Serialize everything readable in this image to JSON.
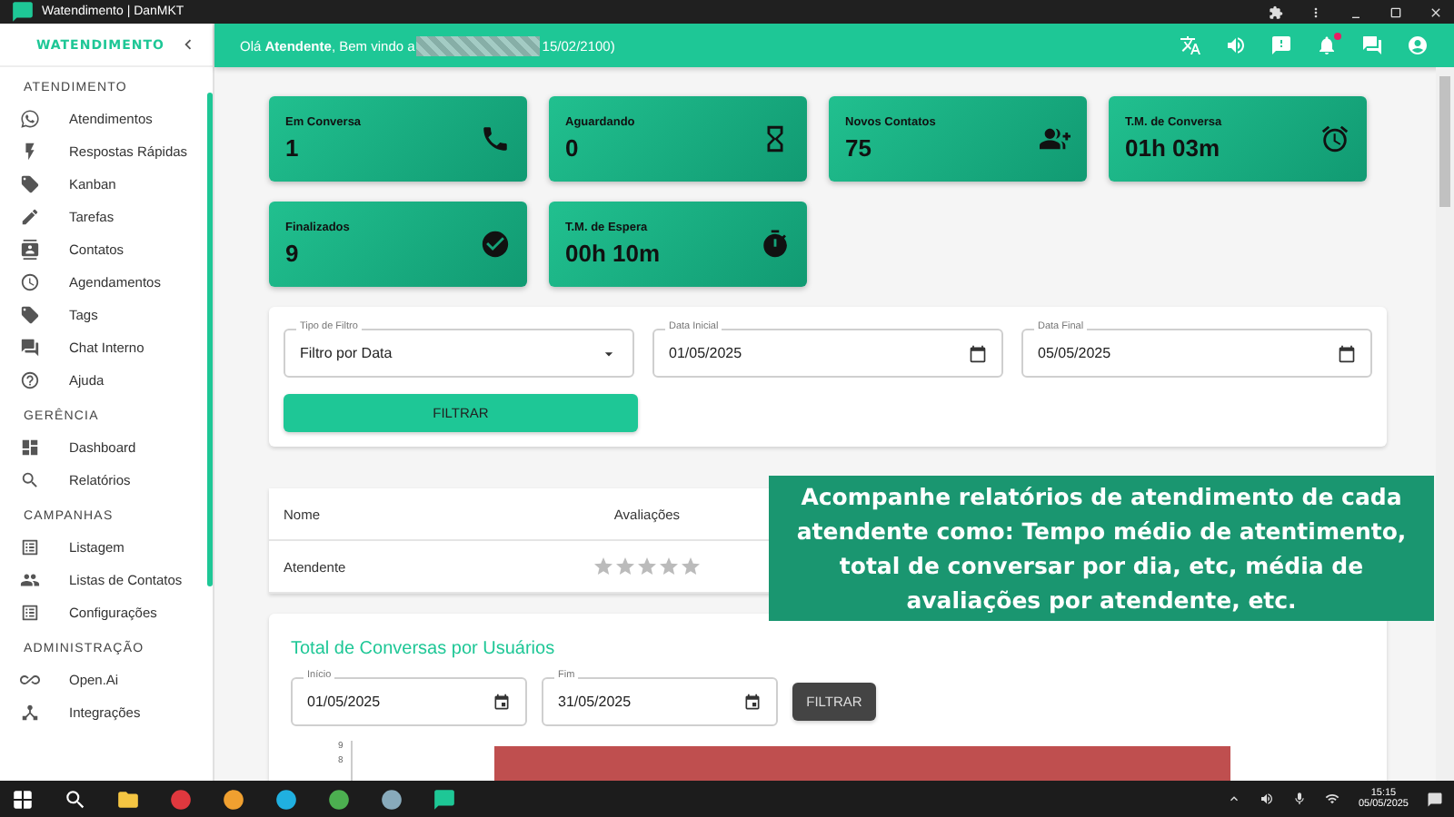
{
  "window": {
    "title": "Watendimento | DanMKT"
  },
  "sidebar": {
    "logo": "WATENDIMENTO",
    "sections": [
      {
        "title": "ATENDIMENTO",
        "items": [
          "Atendimentos",
          "Respostas Rápidas",
          "Kanban",
          "Tarefas",
          "Contatos",
          "Agendamentos",
          "Tags",
          "Chat Interno",
          "Ajuda"
        ]
      },
      {
        "title": "GERÊNCIA",
        "items": [
          "Dashboard",
          "Relatórios"
        ]
      },
      {
        "title": "CAMPANHAS",
        "items": [
          "Listagem",
          "Listas de Contatos",
          "Configurações"
        ]
      },
      {
        "title": "ADMINISTRAÇÃO",
        "items": [
          "Open.Ai",
          "Integrações"
        ]
      }
    ]
  },
  "header": {
    "greeting": "Olá **Atendente**, Bem vindo a",
    "suffix": "15/02/2100)",
    "notification_dot": true
  },
  "cards": [
    {
      "label": "Em Conversa",
      "value": "1"
    },
    {
      "label": "Aguardando",
      "value": "0"
    },
    {
      "label": "Novos Contatos",
      "value": "75"
    },
    {
      "label": "T.M. de Conversa",
      "value": "01h 03m"
    },
    {
      "label": "Finalizados",
      "value": "9"
    },
    {
      "label": "T.M. de Espera",
      "value": "00h 10m"
    }
  ],
  "filter": {
    "fields": [
      {
        "kind": "select",
        "label": "Tipo de Filtro",
        "value": "Filtro por Data"
      },
      {
        "kind": "date",
        "label": "Data Inicial",
        "value": "01/05/2025"
      },
      {
        "kind": "date",
        "label": "Data Final",
        "value": "05/05/2025"
      }
    ],
    "button": "FILTRAR"
  },
  "table": {
    "columns": [
      "Nome",
      "Avaliações"
    ],
    "rows": [
      {
        "name": "Atendente",
        "stars": 0
      }
    ]
  },
  "chart_panel": {
    "title": "Total de Conversas por Usuários",
    "fields": [
      {
        "label": "Início",
        "value": "01/05/2025"
      },
      {
        "label": "Fim",
        "value": "31/05/2025"
      }
    ],
    "button": "FILTRAR",
    "ticks": [
      "9",
      "8"
    ]
  },
  "caption": "Acompanhe relatórios de atendimento de cada atendente como: Tempo médio de atentimento, total de conversar por dia, etc, média de avaliações por atendente, etc.",
  "taskbar": {
    "time": "15:15",
    "date": "05/05/2025"
  }
}
